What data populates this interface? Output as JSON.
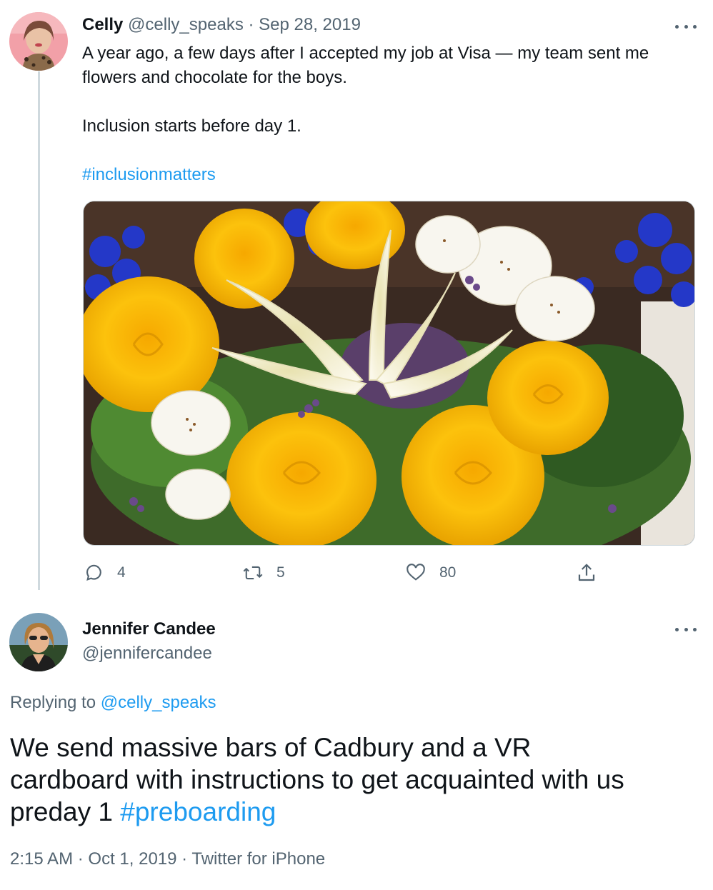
{
  "tweet": {
    "name": "Celly",
    "handle": "@celly_speaks",
    "separator": "·",
    "date": "Sep 28, 2019",
    "text_line1": "A year ago, a few days after I accepted my job at Visa — my team sent me",
    "text_line2": "flowers and chocolate for the boys.",
    "text_line3": "Inclusion starts before day 1.",
    "hashtag": "#inclusionmatters",
    "replies": "4",
    "retweets": "5",
    "likes": "80",
    "icons": {
      "reply": "reply-icon",
      "retweet": "retweet-icon",
      "like": "heart-icon",
      "share": "share-icon",
      "more": "more-icon"
    },
    "photo_alt": "Bouquet of yellow roses, white lilies, alstroemeria and blue delphinium"
  },
  "reply": {
    "name": "Jennifer Candee",
    "handle": "@jennifercandee",
    "replying_prefix": "Replying to",
    "replying_handle": "@celly_speaks",
    "text_line1": "We send massive bars of Cadbury and a VR",
    "text_line2": "cardboard with instructions to get acquainted with us",
    "text_line3_prefix": "preday 1",
    "hashtag": "#preboarding",
    "time": "2:15 AM",
    "date": "Oct 1, 2019",
    "source": "Twitter for iPhone",
    "separator": "·"
  },
  "colors": {
    "link": "#1d9bf0",
    "muted": "#536471",
    "text": "#0f1419",
    "thread_line": "#cfd9de"
  }
}
